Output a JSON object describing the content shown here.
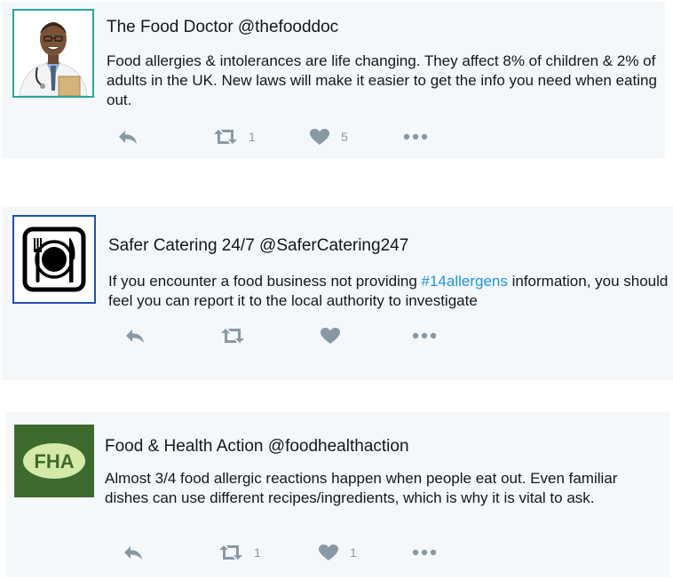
{
  "tweets": [
    {
      "name": "The Food Doctor",
      "handle": "@thefooddoc",
      "text": "Food allergies & intolerances are life changing.  They affect 8% of children & 2% of adults in the UK. New laws will make it easier to get the info you need when eating out.",
      "retweets": "1",
      "likes": "5",
      "avatar_icon": "doctor-photo",
      "avatar_border": "#26a69a"
    },
    {
      "name": "Safer Catering 24/7",
      "handle": "@SaferCatering247",
      "text_before": "If you encounter a food business not providing ",
      "hashtag": "#14allergens",
      "text_after": " information, you should feel you can report it to the local authority to investigate",
      "retweets": "",
      "likes": "",
      "avatar_icon": "plate-cutlery-icon",
      "avatar_border": "#1f4fb5"
    },
    {
      "name": "Food & Health Action",
      "handle": "@foodhealthaction",
      "text": "Almost 3/4 food allergic reactions happen when people eat out. Even familiar dishes can use different recipes/ingredients, which is why it is vital to ask.",
      "retweets": "1",
      "likes": "1",
      "avatar_label": "FHA",
      "avatar_bg": "#3d6b2e",
      "avatar_oval": "#d5eaa8"
    }
  ],
  "colors": {
    "card_bg": "#f5f8fa",
    "icon_gray": "#8899a6",
    "hashtag_blue": "#1b95e0"
  }
}
